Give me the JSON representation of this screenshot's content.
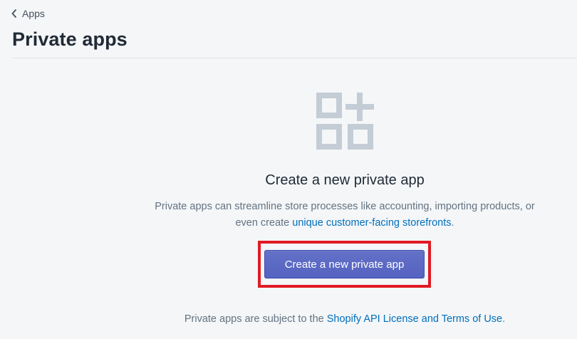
{
  "breadcrumb": {
    "label": "Apps",
    "icon": "chevron-left-icon"
  },
  "page": {
    "title": "Private apps"
  },
  "empty_state": {
    "icon": "apps-add-icon",
    "icon_color": "#c4cdd5",
    "heading": "Create a new private app",
    "description_prefix": "Private apps can streamline store processes like accounting, importing products, or even create",
    "description_link": "unique customer-facing storefronts",
    "description_suffix": ".",
    "button_label": "Create a new private app",
    "button_color": "#5c6ac4"
  },
  "footer": {
    "prefix": "Private apps are subject to the",
    "link": "Shopify API License and Terms of Use",
    "suffix": "."
  },
  "annotation": {
    "highlight_color": "#e01b24"
  }
}
